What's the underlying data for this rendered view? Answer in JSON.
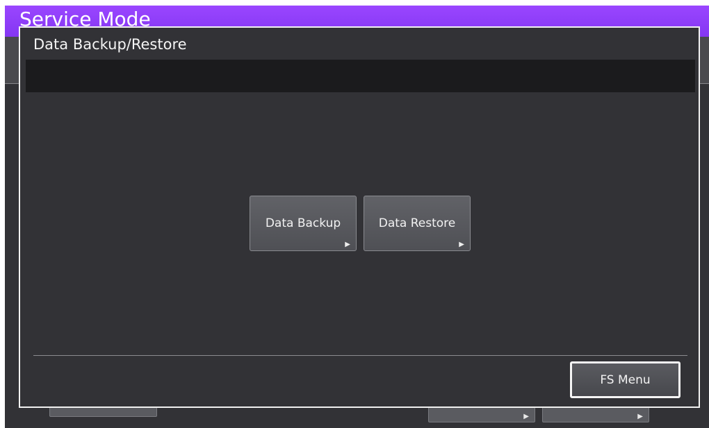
{
  "app": {
    "title": "Service Mode"
  },
  "dialog": {
    "title": "Data Backup/Restore",
    "message": "",
    "buttons": {
      "backup": {
        "label": "Data Backup",
        "arrow": "▶"
      },
      "restore": {
        "label": "Data Restore",
        "arrow": "▶"
      }
    },
    "fs_menu_label": "FS Menu"
  },
  "colors": {
    "header": "#8436f2",
    "background": "#323236",
    "message_bar": "#1b1b1d",
    "dialog_border": "#f2f2f2"
  }
}
